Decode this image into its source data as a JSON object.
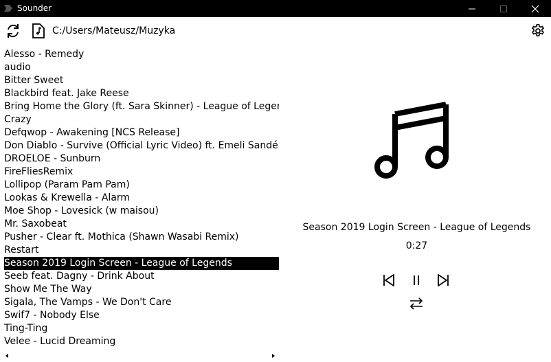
{
  "window": {
    "title": "Sounder"
  },
  "toolbar": {
    "path": "C:/Users/Mateusz/Muzyka"
  },
  "icons": {
    "app": "app-logo-icon",
    "refresh": "refresh-icon",
    "folder": "music-file-icon",
    "settings": "gear-icon",
    "note": "music-note-icon",
    "prev": "skip-previous-icon",
    "pause": "pause-icon",
    "next": "skip-next-icon",
    "repeat": "repeat-icon"
  },
  "tracks": [
    "Alesso - Remedy",
    "audio",
    "Bitter Sweet",
    "Blackbird feat. Jake Reese",
    "Bring Home the Glory (ft. Sara Skinner)  - League of Legends",
    "Crazy",
    "Defqwop - Awakening [NCS Release]",
    "Don Diablo - Survive (Official Lyric Video) ft. Emeli Sandé &",
    "DROELOE - Sunburn",
    "FireFliesRemix",
    "Lollipop (Param Pam Pam)",
    "Lookas & Krewella - Alarm",
    "Moe Shop - Lovesick (w maisou)",
    "Mr. Saxobeat",
    "Pusher - Clear ft. Mothica (Shawn Wasabi Remix)",
    "Restart",
    "Season 2019 Login Screen - League of Legends",
    "Seeb feat. Dagny - Drink About",
    "Show Me The Way",
    "Sigala, The Vamps - We Don't Care",
    "Swif7 - Nobody Else",
    "Ting-Ting",
    "Velee - Lucid Dreaming"
  ],
  "selected_track": "Season 2019 Login Screen - League of Legends",
  "player": {
    "title": "Season 2019 Login Screen - League of Legends",
    "time": "0:27"
  },
  "colors": {
    "titlebar": "#000000",
    "background": "#ffffff",
    "selection": "#000000"
  }
}
